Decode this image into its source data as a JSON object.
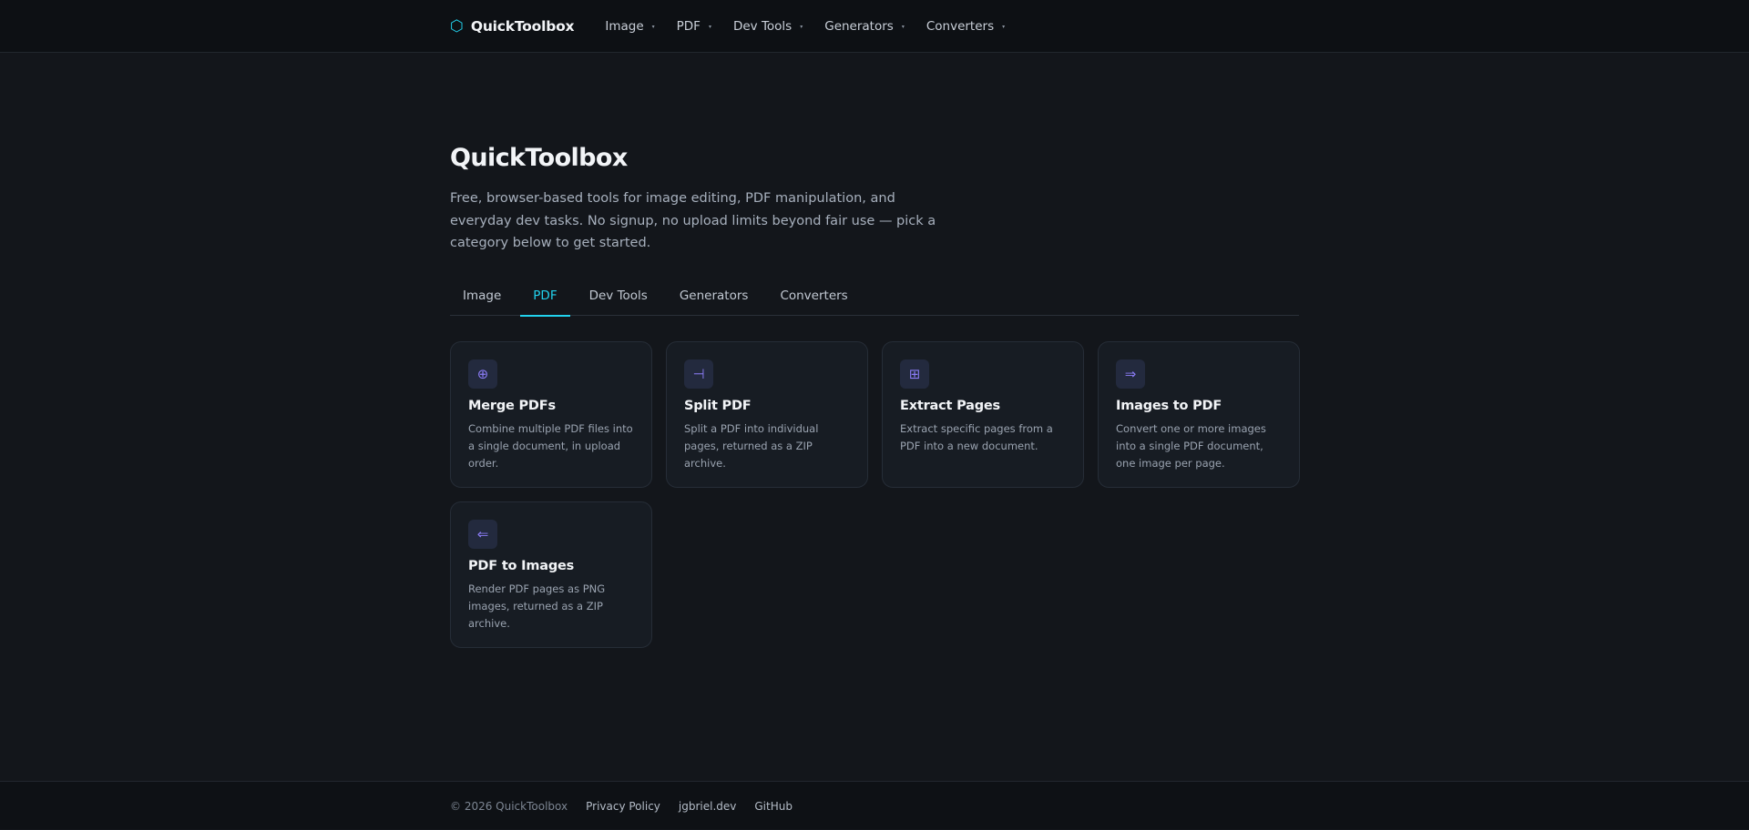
{
  "header": {
    "brand": {
      "icon": "hexagon-icon",
      "icon_glyph": "⬡",
      "name": "QuickToolbox"
    },
    "nav": [
      {
        "label": "Image",
        "caret": "▾"
      },
      {
        "label": "PDF",
        "caret": "▾"
      },
      {
        "label": "Dev Tools",
        "caret": "▾"
      },
      {
        "label": "Generators",
        "caret": "▾"
      },
      {
        "label": "Converters",
        "caret": "▾"
      }
    ]
  },
  "hero": {
    "title": "QuickToolbox",
    "description": "Free, browser-based tools for image editing, PDF manipulation, and everyday dev tasks. No signup, no upload limits beyond fair use — pick a category below to get started."
  },
  "tabs": [
    {
      "label": "Image",
      "active": false
    },
    {
      "label": "PDF",
      "active": true
    },
    {
      "label": "Dev Tools",
      "active": false
    },
    {
      "label": "Generators",
      "active": false
    },
    {
      "label": "Converters",
      "active": false
    }
  ],
  "cards": [
    {
      "icon": "merge-icon",
      "glyph": "⊕",
      "title": "Merge PDFs",
      "desc": "Combine multiple PDF files into a single document, in upload order."
    },
    {
      "icon": "split-icon",
      "glyph": "⊣",
      "title": "Split PDF",
      "desc": "Split a PDF into individual pages, returned as a ZIP archive."
    },
    {
      "icon": "grid-icon",
      "glyph": "⊞",
      "title": "Extract Pages",
      "desc": "Extract specific pages from a PDF into a new document."
    },
    {
      "icon": "arrow-right-icon",
      "glyph": "⇒",
      "title": "Images to PDF",
      "desc": "Convert one or more images into a single PDF document, one image per page."
    },
    {
      "icon": "arrow-left-icon",
      "glyph": "⇐",
      "title": "PDF to Images",
      "desc": "Render PDF pages as PNG images, returned as a ZIP archive."
    }
  ],
  "footer": {
    "copyright": "© 2026 QuickToolbox",
    "links": [
      "Privacy Policy",
      "jgbriel.dev",
      "GitHub"
    ]
  },
  "colors": {
    "background": "#13161b",
    "accent": "#22d3ee",
    "icon_accent": "#8b7cf6",
    "card": "#171c23"
  }
}
